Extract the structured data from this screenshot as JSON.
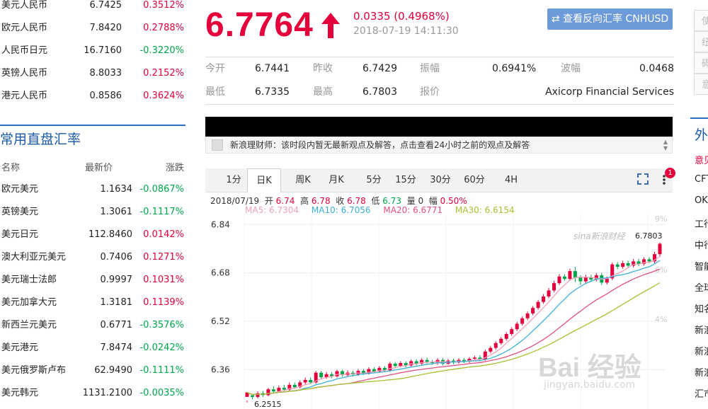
{
  "top_rates": [
    {
      "name": "美元人民币",
      "price": "6.7425",
      "change": "0.3512%",
      "dir": "up"
    },
    {
      "name": "欧元人民币",
      "price": "7.8420",
      "change": "0.2788%",
      "dir": "up"
    },
    {
      "name": "人民币日元",
      "price": "16.7160",
      "change": "-0.3220%",
      "dir": "down"
    },
    {
      "name": "英镑人民币",
      "price": "8.8033",
      "change": "0.2152%",
      "dir": "up"
    },
    {
      "name": "港元人民币",
      "price": "0.8586",
      "change": "0.3624%",
      "dir": "up"
    }
  ],
  "cross_section": {
    "title": "常用直盘汇率",
    "headers": {
      "name": "名称",
      "price": "最新价",
      "change": "涨跌"
    },
    "rows": [
      {
        "name": "欧元美元",
        "price": "1.1634",
        "change": "-0.0867%",
        "dir": "down"
      },
      {
        "name": "英镑美元",
        "price": "1.3061",
        "change": "-0.1117%",
        "dir": "down"
      },
      {
        "name": "美元日元",
        "price": "112.8460",
        "change": "0.0142%",
        "dir": "up"
      },
      {
        "name": "澳大利亚元美元",
        "price": "0.7406",
        "change": "0.1271%",
        "dir": "up"
      },
      {
        "name": "美元瑞士法郎",
        "price": "0.9997",
        "change": "0.1031%",
        "dir": "up"
      },
      {
        "name": "美元加拿大元",
        "price": "1.3181",
        "change": "0.1139%",
        "dir": "up"
      },
      {
        "name": "新西兰元美元",
        "price": "0.6771",
        "change": "-0.3576%",
        "dir": "down"
      },
      {
        "name": "美元港元",
        "price": "7.8474",
        "change": "-0.0242%",
        "dir": "down"
      },
      {
        "name": "美元俄罗斯卢布",
        "price": "62.9490",
        "change": "-0.1111%",
        "dir": "down"
      },
      {
        "name": "美元韩元",
        "price": "1131.2100",
        "change": "-0.0035%",
        "dir": "down"
      }
    ]
  },
  "quote": {
    "price": "6.7764",
    "change": "0.0335 (0.4968%)",
    "time": "2018-07-19 14:11:30",
    "reverse_button": "⇄ 查看反向汇率 CNHUSD"
  },
  "stats": {
    "open_label": "今开",
    "open": "6.7441",
    "prev_close_label": "昨收",
    "prev_close": "6.7429",
    "amplitude_label": "振幅",
    "amplitude": "0.6941%",
    "range_label": "波幅",
    "range": "0.0468",
    "low_label": "最低",
    "low": "6.7335",
    "high_label": "最高",
    "high": "6.7803",
    "quote_label": "报价",
    "quote_source": "Axicorp Financial Services"
  },
  "notice": "新浪理财师：该时段内暂无最新观点及解答，点击查看24小时之前的观点及解答",
  "tabs": [
    "1分",
    "日K",
    "周K",
    "月K",
    "5分",
    "15分",
    "30分",
    "60分",
    "4H"
  ],
  "active_tab": "日K",
  "badge_count": "1",
  "ohlc_bar": {
    "date": "2018/07/19",
    "open_label": "开",
    "open": "6.74",
    "high_label": "高",
    "high": "6.78",
    "close_label": "收",
    "close": "6.78",
    "low_label": "低",
    "low": "6.73",
    "vol_label": "量",
    "vol": "0",
    "amp_label": "幅",
    "amp": "0.50%"
  },
  "ma_legend": {
    "ma5": "MA5: 6.7304",
    "ma10": "MA10: 6.7056",
    "ma20": "MA20: 6.6771",
    "ma30": "MA30: 6.6154"
  },
  "colors": {
    "up": "#e4003a",
    "down": "#00a54a",
    "ma5": "#f0a0b8",
    "ma10": "#3db0d8",
    "ma20": "#e05080",
    "ma30": "#a8c030",
    "accent": "#2a6fc8"
  },
  "chart_data": {
    "type": "candlestick",
    "y_ticks": [
      "6.84",
      "6.68",
      "6.52",
      "6.36"
    ],
    "y_tick_values": [
      6.84,
      6.68,
      6.52,
      6.36
    ],
    "right_ticks": [
      "9%",
      "6%",
      "4%"
    ],
    "ylim": [
      6.23,
      6.85
    ],
    "max_label": "6.7803",
    "max_value": 6.7803,
    "min_label": "6.2515",
    "min_value": 6.2515,
    "logo_text": "sina新浪财经",
    "candles": [
      [
        6.27,
        6.285,
        6.258,
        6.2515
      ],
      [
        6.275,
        6.27,
        6.28,
        6.262
      ],
      [
        6.27,
        6.282,
        6.288,
        6.265
      ],
      [
        6.282,
        6.276,
        6.29,
        6.27
      ],
      [
        6.276,
        6.295,
        6.3,
        6.272
      ],
      [
        6.295,
        6.288,
        6.305,
        6.282
      ],
      [
        6.288,
        6.3,
        6.308,
        6.284
      ],
      [
        6.3,
        6.294,
        6.31,
        6.288
      ],
      [
        6.294,
        6.31,
        6.318,
        6.29
      ],
      [
        6.31,
        6.302,
        6.318,
        6.296
      ],
      [
        6.302,
        6.318,
        6.325,
        6.298
      ],
      [
        6.318,
        6.326,
        6.334,
        6.312
      ],
      [
        6.326,
        6.318,
        6.334,
        6.312
      ],
      [
        6.318,
        6.35,
        6.356,
        6.314
      ],
      [
        6.35,
        6.335,
        6.356,
        6.328
      ],
      [
        6.335,
        6.345,
        6.352,
        6.33
      ],
      [
        6.345,
        6.338,
        6.352,
        6.332
      ],
      [
        6.338,
        6.355,
        6.36,
        6.334
      ],
      [
        6.355,
        6.342,
        6.36,
        6.336
      ],
      [
        6.342,
        6.35,
        6.358,
        6.338
      ],
      [
        6.35,
        6.344,
        6.356,
        6.338
      ],
      [
        6.344,
        6.356,
        6.362,
        6.34
      ],
      [
        6.356,
        6.348,
        6.362,
        6.342
      ],
      [
        6.348,
        6.362,
        6.368,
        6.344
      ],
      [
        6.362,
        6.354,
        6.368,
        6.348
      ],
      [
        6.354,
        6.366,
        6.372,
        6.35
      ],
      [
        6.366,
        6.358,
        6.372,
        6.352
      ],
      [
        6.358,
        6.38,
        6.386,
        6.354
      ],
      [
        6.38,
        6.372,
        6.386,
        6.366
      ],
      [
        6.372,
        6.382,
        6.388,
        6.368
      ],
      [
        6.382,
        6.374,
        6.388,
        6.368
      ],
      [
        6.374,
        6.388,
        6.394,
        6.37
      ],
      [
        6.388,
        6.38,
        6.394,
        6.374
      ],
      [
        6.38,
        6.392,
        6.398,
        6.376
      ],
      [
        6.392,
        6.386,
        6.4,
        6.38
      ],
      [
        6.386,
        6.382,
        6.392,
        6.376
      ],
      [
        6.382,
        6.392,
        6.398,
        6.376
      ],
      [
        6.392,
        6.38,
        6.398,
        6.374
      ],
      [
        6.38,
        6.39,
        6.396,
        6.376
      ],
      [
        6.39,
        6.384,
        6.396,
        6.378
      ],
      [
        6.384,
        6.392,
        6.398,
        6.38
      ],
      [
        6.392,
        6.388,
        6.398,
        6.382
      ],
      [
        6.388,
        6.396,
        6.402,
        6.382
      ],
      [
        6.396,
        6.4,
        6.406,
        6.39
      ],
      [
        6.4,
        6.394,
        6.408,
        6.388
      ],
      [
        6.394,
        6.42,
        6.426,
        6.39
      ],
      [
        6.42,
        6.432,
        6.438,
        6.414
      ],
      [
        6.432,
        6.448,
        6.454,
        6.426
      ],
      [
        6.448,
        6.462,
        6.468,
        6.442
      ],
      [
        6.462,
        6.478,
        6.484,
        6.456
      ],
      [
        6.478,
        6.494,
        6.5,
        6.472
      ],
      [
        6.494,
        6.512,
        6.518,
        6.488
      ],
      [
        6.512,
        6.53,
        6.536,
        6.506
      ],
      [
        6.53,
        6.546,
        6.552,
        6.524
      ],
      [
        6.546,
        6.564,
        6.57,
        6.54
      ],
      [
        6.564,
        6.584,
        6.59,
        6.558
      ],
      [
        6.584,
        6.602,
        6.61,
        6.578
      ],
      [
        6.602,
        6.622,
        6.63,
        6.596
      ],
      [
        6.622,
        6.646,
        6.654,
        6.616
      ],
      [
        6.646,
        6.668,
        6.676,
        6.64
      ],
      [
        6.668,
        6.66,
        6.676,
        6.654
      ],
      [
        6.66,
        6.686,
        6.694,
        6.654
      ],
      [
        6.686,
        6.664,
        6.7,
        6.65
      ],
      [
        6.664,
        6.652,
        6.672,
        6.64
      ],
      [
        6.652,
        6.666,
        6.674,
        6.646
      ],
      [
        6.666,
        6.658,
        6.674,
        6.65
      ],
      [
        6.658,
        6.672,
        6.68,
        6.652
      ],
      [
        6.672,
        6.648,
        6.68,
        6.64
      ],
      [
        6.648,
        6.662,
        6.668,
        6.642
      ],
      [
        6.662,
        6.708,
        6.714,
        6.656
      ],
      [
        6.708,
        6.7,
        6.716,
        6.692
      ],
      [
        6.7,
        6.712,
        6.72,
        6.694
      ],
      [
        6.712,
        6.704,
        6.72,
        6.696
      ],
      [
        6.704,
        6.718,
        6.726,
        6.698
      ],
      [
        6.718,
        6.71,
        6.726,
        6.702
      ],
      [
        6.71,
        6.725,
        6.732,
        6.704
      ],
      [
        6.725,
        6.718,
        6.732,
        6.712
      ],
      [
        6.718,
        6.742,
        6.75,
        6.712
      ],
      [
        6.742,
        6.7764,
        6.7803,
        6.7335
      ]
    ]
  },
  "right_rail": {
    "boxes": [
      "使",
      "纽",
      "碍",
      "意"
    ],
    "title": "外",
    "links": [
      "意见",
      "CFT",
      "OK",
      "工行",
      "中行",
      "智能",
      "全球",
      "知名",
      "新浪",
      "新浪",
      "新浪",
      "汇市"
    ]
  },
  "watermark": "Bai 经验",
  "watermark_url": "jingyan.baidu.com"
}
